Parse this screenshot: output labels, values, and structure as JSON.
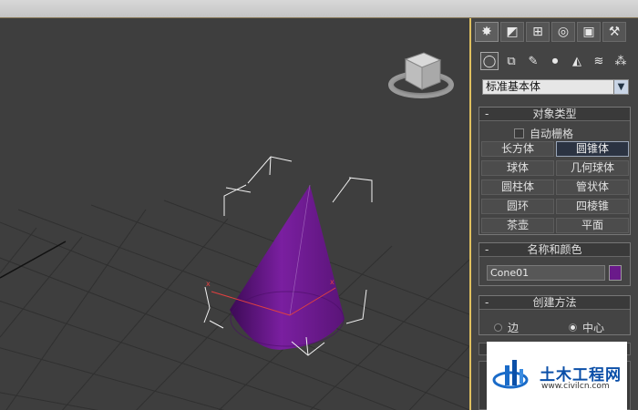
{
  "command_panel": {
    "tabs": [
      {
        "icon": "create-icon",
        "glyph": "✸"
      },
      {
        "icon": "modify-icon",
        "glyph": "◩"
      },
      {
        "icon": "hierarchy-icon",
        "glyph": "⊞"
      },
      {
        "icon": "motion-icon",
        "glyph": "◎"
      },
      {
        "icon": "display-icon",
        "glyph": "▣"
      },
      {
        "icon": "utilities-icon",
        "glyph": "⚒"
      }
    ],
    "categories": [
      {
        "icon": "geometry-icon",
        "glyph": "◯"
      },
      {
        "icon": "shapes-icon",
        "glyph": "⧉"
      },
      {
        "icon": "lights-icon",
        "glyph": "✎"
      },
      {
        "icon": "cameras-icon",
        "glyph": "⏺"
      },
      {
        "icon": "helpers-icon",
        "glyph": "◭"
      },
      {
        "icon": "spacewarps-icon",
        "glyph": "≋"
      },
      {
        "icon": "systems-icon",
        "glyph": "⁂"
      }
    ],
    "dropdown_value": "标准基本体",
    "object_type": {
      "title": "对象类型",
      "autogrid_label": "自动栅格",
      "buttons": [
        "长方体",
        "圆锥体",
        "球体",
        "几何球体",
        "圆柱体",
        "管状体",
        "圆环",
        "四棱锥",
        "茶壶",
        "平面"
      ]
    },
    "name_color": {
      "title": "名称和颜色",
      "name_value": "Cone01",
      "color": "#6a1a8a"
    },
    "creation_method": {
      "title": "创建方法",
      "options": [
        "边",
        "中心"
      ],
      "selected": "中心"
    },
    "minus": "-"
  },
  "watermark": {
    "title": "土木工程网",
    "url": "www.civilcn.com"
  },
  "colors": {
    "cone": "#6a1a8a",
    "viewport_bg": "#3e3e3e",
    "active_border": "#e0c060"
  }
}
